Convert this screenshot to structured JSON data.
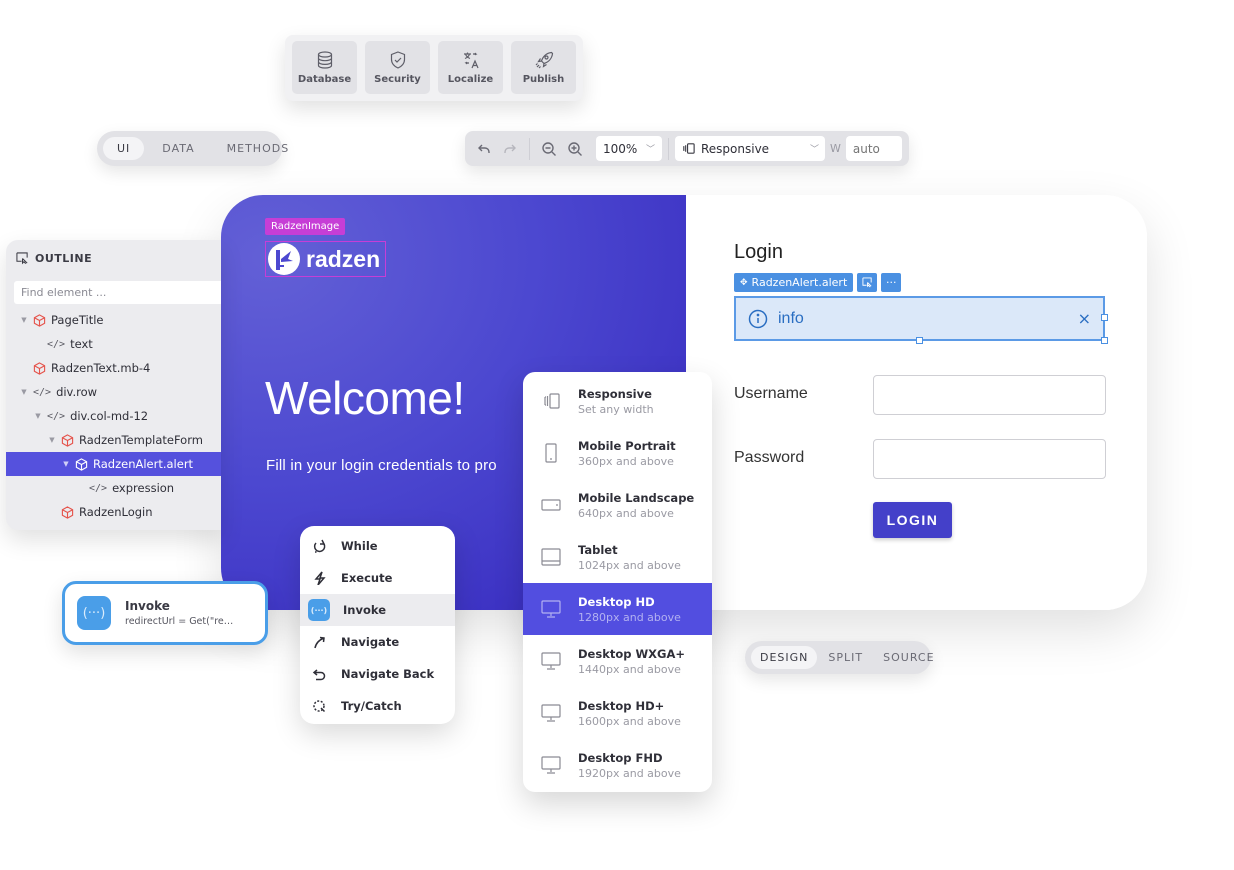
{
  "tools_panel": {
    "buttons": [
      {
        "label": "Database",
        "icon": "database-icon"
      },
      {
        "label": "Security",
        "icon": "shield-check-icon"
      },
      {
        "label": "Localize",
        "icon": "translate-icon"
      },
      {
        "label": "Publish",
        "icon": "rocket-icon"
      }
    ]
  },
  "mode_switch": {
    "options": [
      "UI",
      "DATA",
      "METHODS"
    ],
    "active": "UI"
  },
  "toolbar": {
    "zoom_value": "100%",
    "device_value": "Responsive",
    "width_label": "W",
    "width_placeholder": "auto"
  },
  "canvas": {
    "image_tag": "RadzenImage",
    "logo_text": "radzen",
    "welcome_title": "Welcome!",
    "welcome_subtitle": "Fill in your login credentials to pro",
    "login_title": "Login",
    "alert_tag": "RadzenAlert.alert",
    "alert_more": "···",
    "alert_message": "info",
    "alert_close": "×",
    "username_label": "Username",
    "password_label": "Password",
    "username_value": "",
    "password_value": "",
    "login_button": "LOGIN",
    "colors": {
      "hero": "#4c48d0",
      "image_tag": "#c63ed6",
      "alert_bg": "#dbe8f9",
      "alert_border": "#5b9ae6",
      "login_button": "#4440c9"
    }
  },
  "outline": {
    "title": "OUTLINE",
    "search_placeholder": "Find element ...",
    "items": [
      {
        "label": "PageTitle",
        "type": "component",
        "depth": 0,
        "expanded": true
      },
      {
        "label": "text",
        "type": "code",
        "depth": 1,
        "expanded": null
      },
      {
        "label": "RadzenText.mb-4",
        "type": "component",
        "depth": 0,
        "expanded": null
      },
      {
        "label": "div.row",
        "type": "code",
        "depth": 0,
        "expanded": true
      },
      {
        "label": "div.col-md-12",
        "type": "code",
        "depth": 1,
        "expanded": true
      },
      {
        "label": "RadzenTemplateForm",
        "type": "component",
        "depth": 2,
        "expanded": true
      },
      {
        "label": "RadzenAlert.alert",
        "type": "component",
        "depth": 3,
        "expanded": true,
        "selected": true
      },
      {
        "label": "expression",
        "type": "code",
        "depth": 4,
        "expanded": null
      },
      {
        "label": "RadzenLogin",
        "type": "component",
        "depth": 2,
        "expanded": null
      }
    ]
  },
  "invoke_card": {
    "icon_text": "(···)",
    "title": "Invoke",
    "subtitle": "redirectUrl = Get(\"re…"
  },
  "actions_menu": {
    "items": [
      {
        "label": "While",
        "icon": "loop-icon"
      },
      {
        "label": "Execute",
        "icon": "lightning-icon"
      },
      {
        "label": "Invoke",
        "icon": "invoke-icon",
        "highlighted": true
      },
      {
        "label": "Navigate",
        "icon": "arrow-up-right-icon"
      },
      {
        "label": "Navigate Back",
        "icon": "undo-arrow-icon"
      },
      {
        "label": "Try/Catch",
        "icon": "try-catch-icon"
      }
    ]
  },
  "device_menu": {
    "items": [
      {
        "name": "Responsive",
        "desc": "Set any width",
        "icon": "responsive-icon"
      },
      {
        "name": "Mobile Portrait",
        "desc": "360px and above",
        "icon": "phone-portrait-icon"
      },
      {
        "name": "Mobile Landscape",
        "desc": "640px and above",
        "icon": "phone-landscape-icon"
      },
      {
        "name": "Tablet",
        "desc": "1024px and above",
        "icon": "tablet-icon"
      },
      {
        "name": "Desktop HD",
        "desc": "1280px and above",
        "icon": "monitor-icon",
        "selected": true
      },
      {
        "name": "Desktop WXGA+",
        "desc": "1440px and above",
        "icon": "monitor-icon"
      },
      {
        "name": "Desktop HD+",
        "desc": "1600px and above",
        "icon": "monitor-icon"
      },
      {
        "name": "Desktop FHD",
        "desc": "1920px and above",
        "icon": "monitor-icon"
      }
    ]
  },
  "view_switch": {
    "options": [
      "DESIGN",
      "SPLIT",
      "SOURCE"
    ],
    "active": "DESIGN"
  }
}
